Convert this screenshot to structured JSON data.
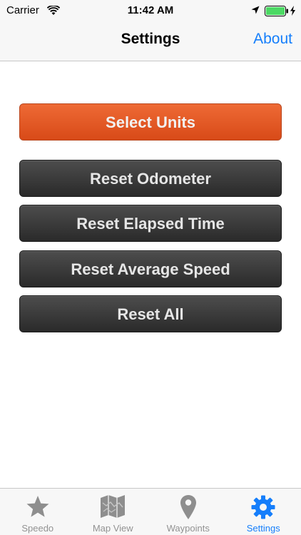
{
  "status_bar": {
    "carrier": "Carrier",
    "time": "11:42 AM",
    "battery_color": "#4cd964"
  },
  "nav": {
    "title": "Settings",
    "about_label": "About",
    "accent_color": "#157efb"
  },
  "buttons": {
    "select_units": "Select Units",
    "reset_odometer": "Reset Odometer",
    "reset_elapsed_time": "Reset Elapsed Time",
    "reset_average_speed": "Reset Average Speed",
    "reset_all": "Reset All"
  },
  "tabs": [
    {
      "label": "Speedo",
      "icon": "star-icon",
      "active": false
    },
    {
      "label": "Map View",
      "icon": "map-icon",
      "active": false
    },
    {
      "label": "Waypoints",
      "icon": "pin-icon",
      "active": false
    },
    {
      "label": "Settings",
      "icon": "gear-icon",
      "active": true
    }
  ]
}
